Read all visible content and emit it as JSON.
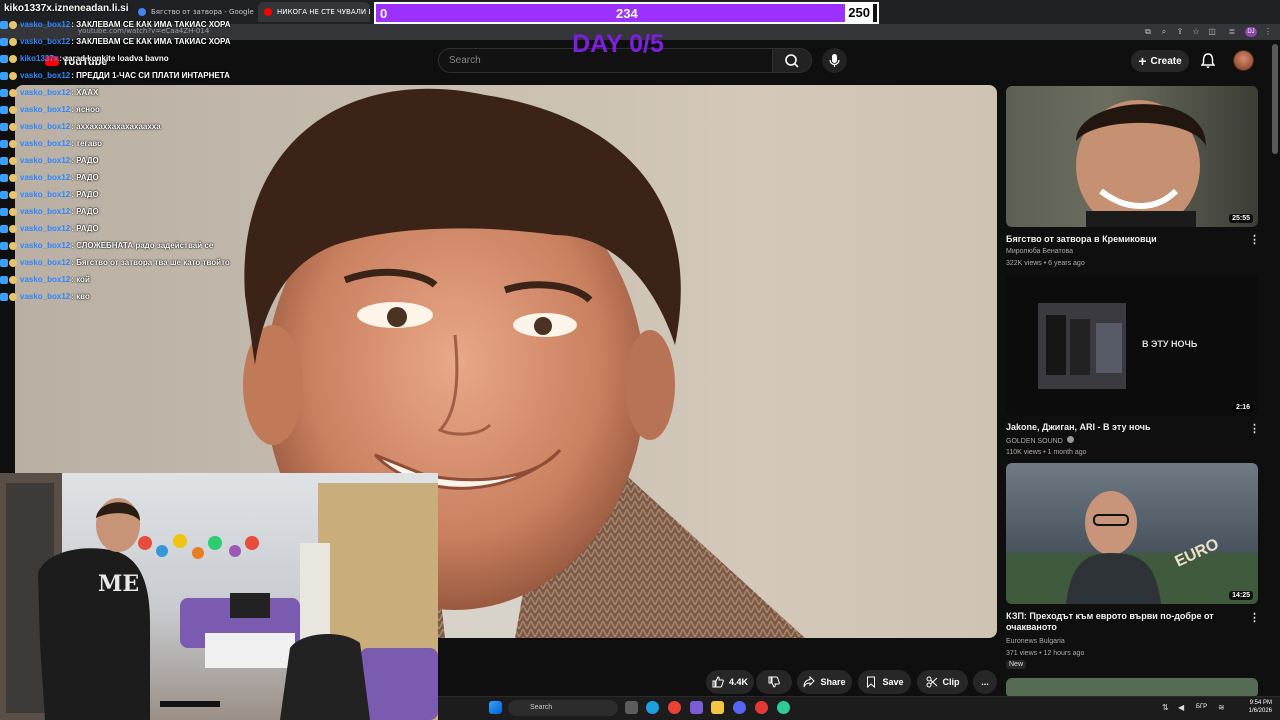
{
  "browser": {
    "tabs": [
      {
        "label": "ЗАКЛЕВАМ СЕ КАК ИМА ТАКИАС ХОРА",
        "active": false
      },
      {
        "label": "Бягство от затвора - Google Т",
        "active": false
      },
      {
        "label": "НИКОГА НЕ СТЕ ЧУВАЛИ ИСТ",
        "active": true
      }
    ],
    "url": "youtube.com/watch?v=eCaa4ZH-014"
  },
  "overlay": {
    "channel": "kiko1337x.izneneadan.li.si",
    "goal_current": "0",
    "goal_mid": "234",
    "goal_target": "250",
    "goal_fill_fraction": 0.94,
    "day_text": "DAY 0/5",
    "bar_color": "#9b30ff"
  },
  "youtube": {
    "logo": "YouTube",
    "search_placeholder": "Search",
    "create_label": "Create"
  },
  "chat": [
    {
      "user": "vasko_box12",
      "msg": ": ЗАКЛЕВАМ СЕ КАК ИМА ТАКИАС ХОРА"
    },
    {
      "user": "vasko_box12",
      "msg": ": ЗАКЛЕВАМ СЕ КАК ИМА ТАКИАС ХОРА"
    },
    {
      "user": "kiko1337x",
      "msg": ": zarad konkite loadva bavno"
    },
    {
      "user": "vasko_box12",
      "msg": ": ПРЕДДИ 1-ЧАС СИ ПЛАТИ ИНТАРНЕТА"
    },
    {
      "user": "vasko_box12",
      "msg": ": ХААХ"
    },
    {
      "user": "vasko_box12",
      "msg": ": ясноо"
    },
    {
      "user": "vasko_box12",
      "msg": ": аххахаххахахахаахха"
    },
    {
      "user": "vasko_box12",
      "msg": ": тегаво"
    },
    {
      "user": "vasko_box12",
      "msg": ": РАДО"
    },
    {
      "user": "vasko_box12",
      "msg": ": РАДО"
    },
    {
      "user": "vasko_box12",
      "msg": ": РАДО"
    },
    {
      "user": "vasko_box12",
      "msg": ": РАДО"
    },
    {
      "user": "vasko_box12",
      "msg": ": РАДО"
    },
    {
      "user": "vasko_box12",
      "msg": ": СЛОЖЕБНАТА радо задействай се"
    },
    {
      "user": "vasko_box12",
      "msg": ": Бягство от затвора тва ше като твойто"
    },
    {
      "user": "vasko_box12",
      "msg": ": кой"
    },
    {
      "user": "vasko_box12",
      "msg": ": кво"
    }
  ],
  "actions": {
    "likes": "4.4K",
    "share": "Share",
    "save": "Save",
    "clip": "Clip",
    "more": "..."
  },
  "recommendations": [
    {
      "title": "Бягство от затвора в Кремиковци",
      "channel": "Миролюба Бенатова",
      "meta": "322K views • 6 years ago",
      "duration": "25:55"
    },
    {
      "title": "Jakone, Джиган, ARI - В эту ночь",
      "channel": "GOLDEN SOUND",
      "meta": "110K views • 1 month ago",
      "duration": "2:16",
      "thumb_text": "В ЭТУ НОЧЬ"
    },
    {
      "title": "КЗП: Преходът към еврото върви по-добре от очакваното",
      "channel": "Euronews Bulgaria",
      "meta": "371 views • 12 hours ago",
      "duration": "14:25",
      "badge": "New",
      "thumb_text": "EURO"
    }
  ],
  "taskbar": {
    "search_label": "Search",
    "lang": "БГР",
    "time": "9:54 PM",
    "date": "1/6/2026"
  }
}
